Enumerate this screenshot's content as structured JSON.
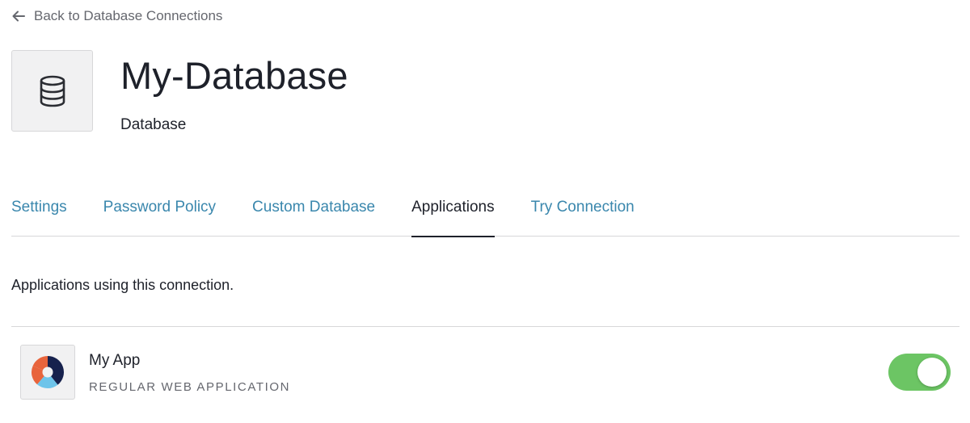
{
  "back_link": {
    "icon": "arrow-left-icon",
    "label": "Back to Database Connections"
  },
  "connection": {
    "icon": "database-icon",
    "name": "My-Database",
    "type": "Database"
  },
  "tabs": [
    {
      "label": "Settings",
      "active": false
    },
    {
      "label": "Password Policy",
      "active": false
    },
    {
      "label": "Custom Database",
      "active": false
    },
    {
      "label": "Applications",
      "active": true
    },
    {
      "label": "Try Connection",
      "active": false
    }
  ],
  "applications_section": {
    "description": "Applications using this connection.",
    "apps": [
      {
        "name": "My App",
        "type": "REGULAR WEB APPLICATION",
        "logo": "app-logo-icon",
        "enabled": true
      }
    ]
  },
  "colors": {
    "link": "#3a87ad",
    "text": "#1e212a",
    "muted": "#65676e",
    "toggle_on": "#6cc564",
    "border": "#d7d7d9"
  }
}
